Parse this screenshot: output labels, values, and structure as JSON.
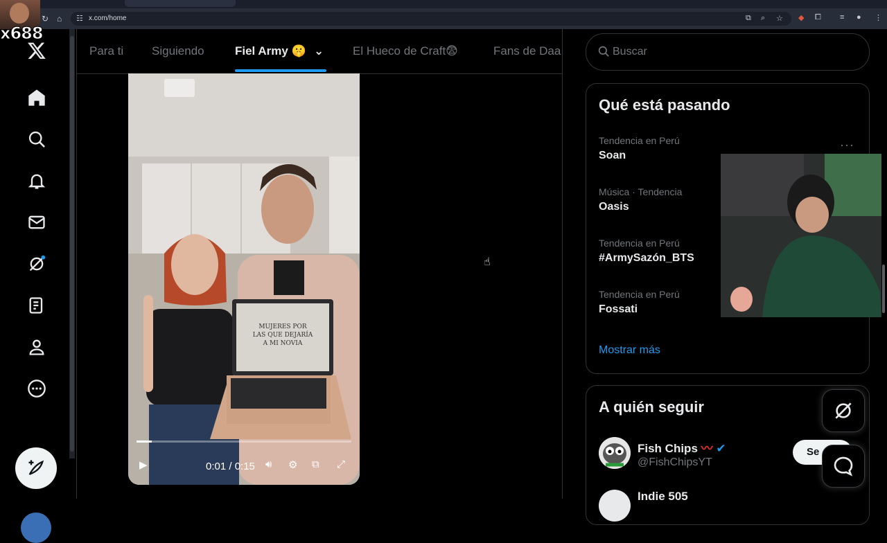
{
  "browser": {
    "tab_title": "",
    "url": "x.com/home"
  },
  "overlay": {
    "streamer_name": "x688"
  },
  "feed_tabs": [
    {
      "label": "Para ti"
    },
    {
      "label": "Siguiendo"
    },
    {
      "label": "Fiel Army 🤫",
      "active": true
    },
    {
      "label": "El Hueco de Craft😨"
    },
    {
      "label": "Fans de Daa"
    }
  ],
  "video": {
    "laptop_text": "MUJERES POR LAS QUE DEJARÍA A MI NOVIA",
    "time": "0:01 / 0:15",
    "progress": 0.07
  },
  "search": {
    "placeholder": "Buscar"
  },
  "trends": {
    "title": "Qué está pasando",
    "items": [
      {
        "meta": "Tendencia en Perú",
        "name": "Soan"
      },
      {
        "meta": "Música · Tendencia",
        "name": "Oasis"
      },
      {
        "meta": "Tendencia en Perú",
        "name": "#ArmySazón_BTS"
      },
      {
        "meta": "Tendencia en Perú",
        "name": "Fossati"
      }
    ],
    "more_label": "···",
    "show_more": "Mostrar más"
  },
  "who_to_follow": {
    "title": "A quién seguir",
    "accounts": [
      {
        "name": "Fish Chips",
        "handle": "@FishChipsYT",
        "button": "Se"
      },
      {
        "name": "Indie 505"
      }
    ]
  },
  "colors": {
    "accent": "#1d9bf0",
    "background": "#000000",
    "border": "#2f3336"
  }
}
